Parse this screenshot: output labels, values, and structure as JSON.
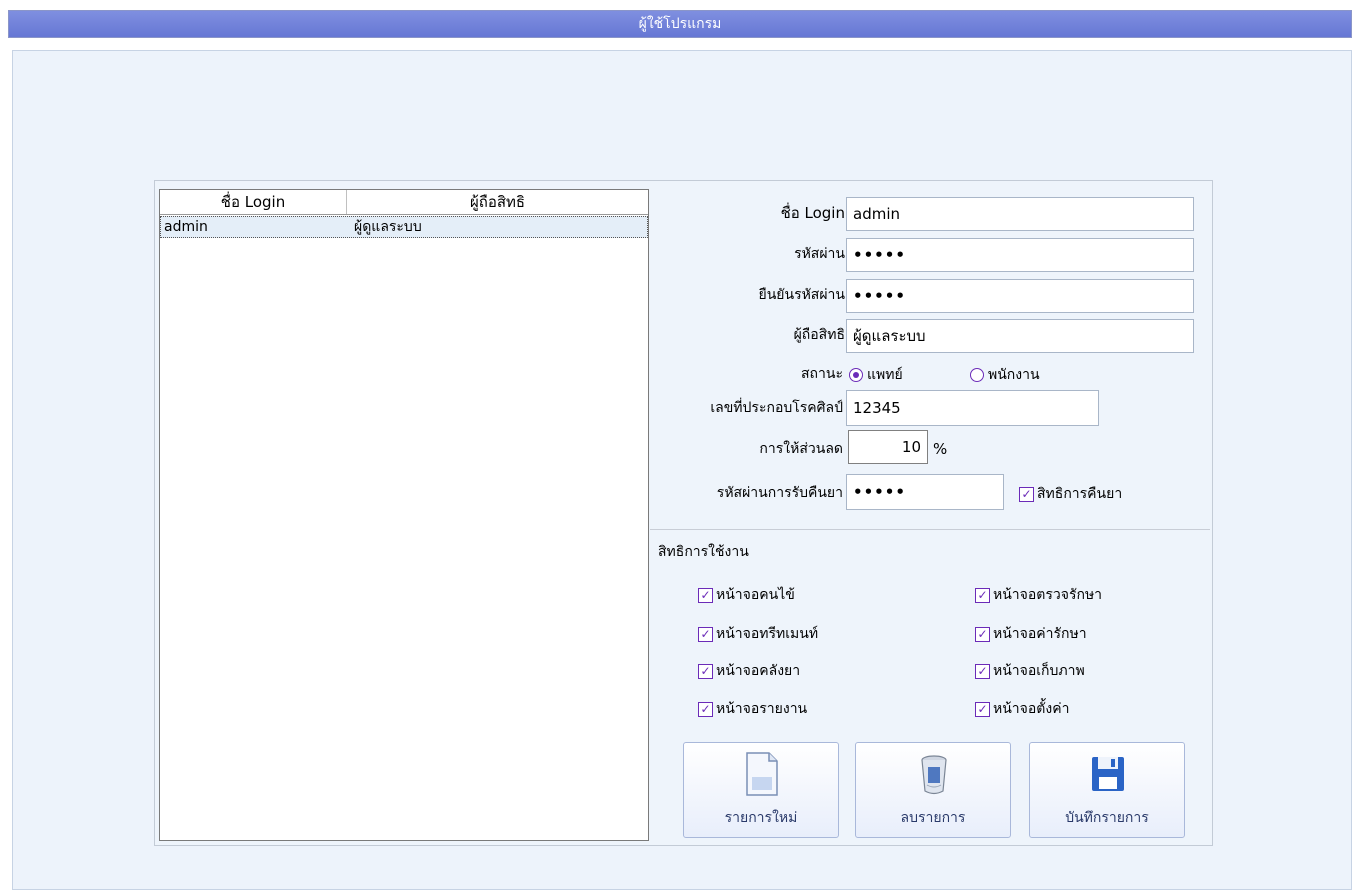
{
  "window": {
    "title": "ผู้ใช้โปรแกรม"
  },
  "user_grid": {
    "columns": [
      "ชื่อ Login",
      "ผู้ถือสิทธิ"
    ],
    "rows": [
      {
        "login": "admin",
        "role": "ผู้ดูแลระบบ"
      }
    ]
  },
  "form": {
    "login_label": "ชื่อ Login",
    "login_value": "admin",
    "password_label": "รหัสผ่าน",
    "password_value": "•••••",
    "confirm_label": "ยืนยันรหัสผ่าน",
    "confirm_value": "•••••",
    "role_label": "ผู้ถือสิทธิ",
    "role_value": "ผู้ดูแลระบบ",
    "status_label": "สถานะ",
    "status_options": [
      "แพทย์",
      "พนักงาน"
    ],
    "status_selected": "แพทย์",
    "license_label": "เลขที่ประกอบโรคศิลป์",
    "license_value": "12345",
    "discount_label": "การให้ส่วนลด",
    "discount_value": "10",
    "discount_unit": "%",
    "refund_pw_label": "รหัสผ่านการรับคืนยา",
    "refund_pw_value": "•••••",
    "refund_right_label": "สิทธิการคืนยา",
    "refund_right_checked": true
  },
  "permissions": {
    "title": "สิทธิการใช้งาน",
    "items": [
      {
        "label": "หน้าจอคนไข้",
        "checked": true
      },
      {
        "label": "หน้าจอตรวจรักษา",
        "checked": true
      },
      {
        "label": "หน้าจอทรีทเมนท์",
        "checked": true
      },
      {
        "label": "หน้าจอค่ารักษา",
        "checked": true
      },
      {
        "label": "หน้าจอคลังยา",
        "checked": true
      },
      {
        "label": "หน้าจอเก็บภาพ",
        "checked": true
      },
      {
        "label": "หน้าจอรายงาน",
        "checked": true
      },
      {
        "label": "หน้าจอตั้งค่า",
        "checked": true
      }
    ]
  },
  "buttons": {
    "new_label": "รายการใหม่",
    "delete_label": "ลบรายการ",
    "save_label": "บันทึกรายการ"
  },
  "colors": {
    "titlebar": "#6f80d9",
    "accent": "#6b2bb8",
    "background": "#edf3fb"
  }
}
